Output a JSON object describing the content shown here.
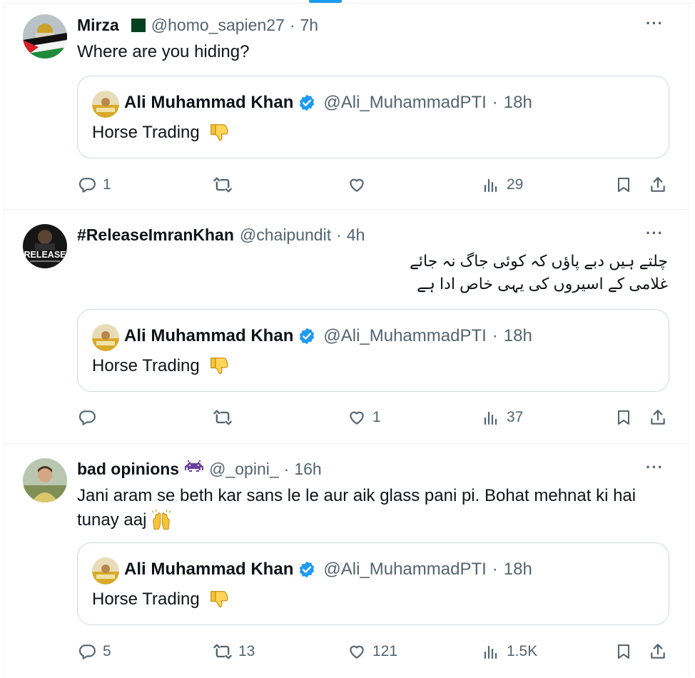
{
  "tweets": [
    {
      "name": "Mirza",
      "handle": "@homo_sapien27",
      "separator": "·",
      "time": "7h",
      "text": "Where are you hiding?",
      "quote": {
        "name": "Ali Muhammad Khan",
        "handle": "@Ali_MuhammadPTI",
        "separator": "·",
        "time": "18h",
        "text": "Horse Trading"
      },
      "actions": {
        "replies": "1",
        "retweets": "",
        "likes": "",
        "views": "29"
      }
    },
    {
      "name": "#ReleaseImranKhan",
      "handle": "@chaipundit",
      "separator": "·",
      "time": "4h",
      "text_line1": "چلتے ہیں دبے پاؤں کہ کوئی جاگ نہ جائے",
      "text_line2": "غلامی کے اسیروں کی یہی خاص ادا ہے",
      "avatar_text": "RELEASE",
      "quote": {
        "name": "Ali Muhammad Khan",
        "handle": "@Ali_MuhammadPTI",
        "separator": "·",
        "time": "18h",
        "text": "Horse Trading"
      },
      "actions": {
        "replies": "",
        "retweets": "",
        "likes": "1",
        "views": "37"
      }
    },
    {
      "name": "bad opinions",
      "handle": "@_opini_",
      "separator": "·",
      "time": "16h",
      "text_line1": "Jani aram se beth kar sans le le aur aik glass pani pi. Bohat mehnat ki hai",
      "text_line2": "tunay aaj",
      "quote": {
        "name": "Ali Muhammad Khan",
        "handle": "@Ali_MuhammadPTI",
        "separator": "·",
        "time": "18h",
        "text": "Horse Trading"
      },
      "actions": {
        "replies": "5",
        "retweets": "13",
        "likes": "121",
        "views": "1.5K"
      }
    }
  ],
  "colors": {
    "text": "#0f1419",
    "secondary": "#536471",
    "accent": "#1d9bf0",
    "border": "#cfd9de",
    "divider": "#eff3f4"
  },
  "icons": [
    "more-icon",
    "verified-badge-icon",
    "thumbs-down-emoji",
    "raising-hands-emoji",
    "alien-monster-emoji",
    "pakistan-flag-icon",
    "reply-icon",
    "retweet-icon",
    "like-icon",
    "views-icon",
    "bookmark-icon",
    "share-icon"
  ]
}
